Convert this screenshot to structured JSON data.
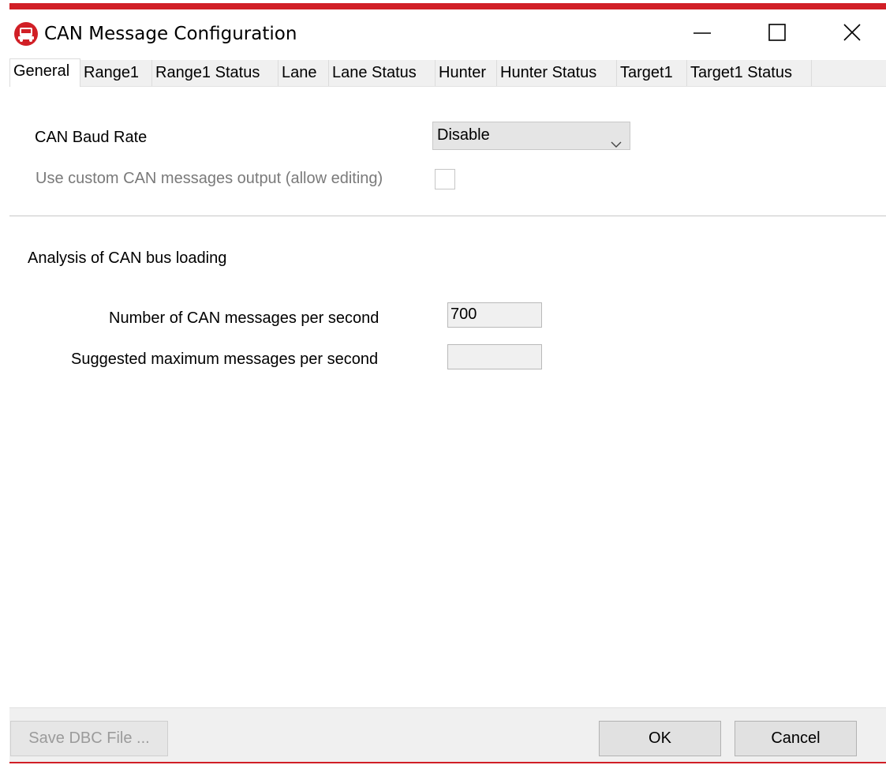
{
  "window": {
    "title": "CAN Message Configuration",
    "accent_color": "#d11f26",
    "icon": "app-logo-icon"
  },
  "controls": {
    "minimize_icon": "minimize-icon",
    "maximize_icon": "maximize-icon",
    "close_icon": "close-icon"
  },
  "tabs": [
    {
      "label": "General",
      "active": true
    },
    {
      "label": "Range1"
    },
    {
      "label": "Range1 Status"
    },
    {
      "label": "Lane"
    },
    {
      "label": "Lane Status"
    },
    {
      "label": "Hunter"
    },
    {
      "label": "Hunter Status"
    },
    {
      "label": "Target1"
    },
    {
      "label": "Target1 Status"
    }
  ],
  "general": {
    "baud_rate_label": "CAN Baud Rate",
    "baud_rate_value": "Disable",
    "custom_output_label": "Use custom CAN messages output (allow editing)",
    "custom_output_checked": false,
    "analysis_heading": "Analysis of CAN bus loading",
    "messages_per_second_label": "Number of CAN messages per second",
    "messages_per_second_value": "700",
    "suggested_max_label": "Suggested maximum messages per second",
    "suggested_max_value": ""
  },
  "footer": {
    "save_dbc_label": "Save DBC File ...",
    "ok_label": "OK",
    "cancel_label": "Cancel"
  }
}
